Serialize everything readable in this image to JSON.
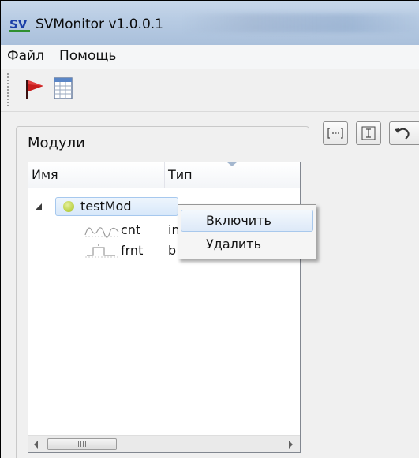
{
  "window": {
    "title": "SVMonitor v1.0.0.1",
    "logo_text": "SV"
  },
  "menu": {
    "items": [
      {
        "label": "Файл"
      },
      {
        "label": "Помощь"
      }
    ]
  },
  "toolbar": {
    "buttons": [
      {
        "icon": "red-flag-icon"
      },
      {
        "icon": "table-icon"
      }
    ]
  },
  "modules_panel": {
    "title": "Модули",
    "columns": [
      "Имя",
      "Тип"
    ],
    "tree": {
      "root": {
        "name": "testMod",
        "status_color": "#bfd44c",
        "expanded": true,
        "selected": true
      },
      "children": [
        {
          "icon": "analog-signal-icon",
          "name": "cnt",
          "type": "in"
        },
        {
          "icon": "digital-signal-icon",
          "name": "frnt",
          "type": "b"
        }
      ]
    },
    "scrollbar": {
      "thumb_label": "III"
    }
  },
  "context_menu": {
    "items": [
      {
        "label": "Включить",
        "highlighted": true
      },
      {
        "label": "Удалить",
        "highlighted": false
      }
    ]
  },
  "right_toolbar": {
    "buttons": [
      {
        "label": "[--]",
        "icon": "bracket-icon"
      },
      {
        "icon": "fit-vertical-icon"
      },
      {
        "icon": "undo-icon"
      }
    ]
  },
  "colors": {
    "titlebar": "#b7cbe3",
    "selection": "#d8e8fa",
    "selection_border": "#a6c8ee",
    "status_ok": "#bfd44c"
  }
}
